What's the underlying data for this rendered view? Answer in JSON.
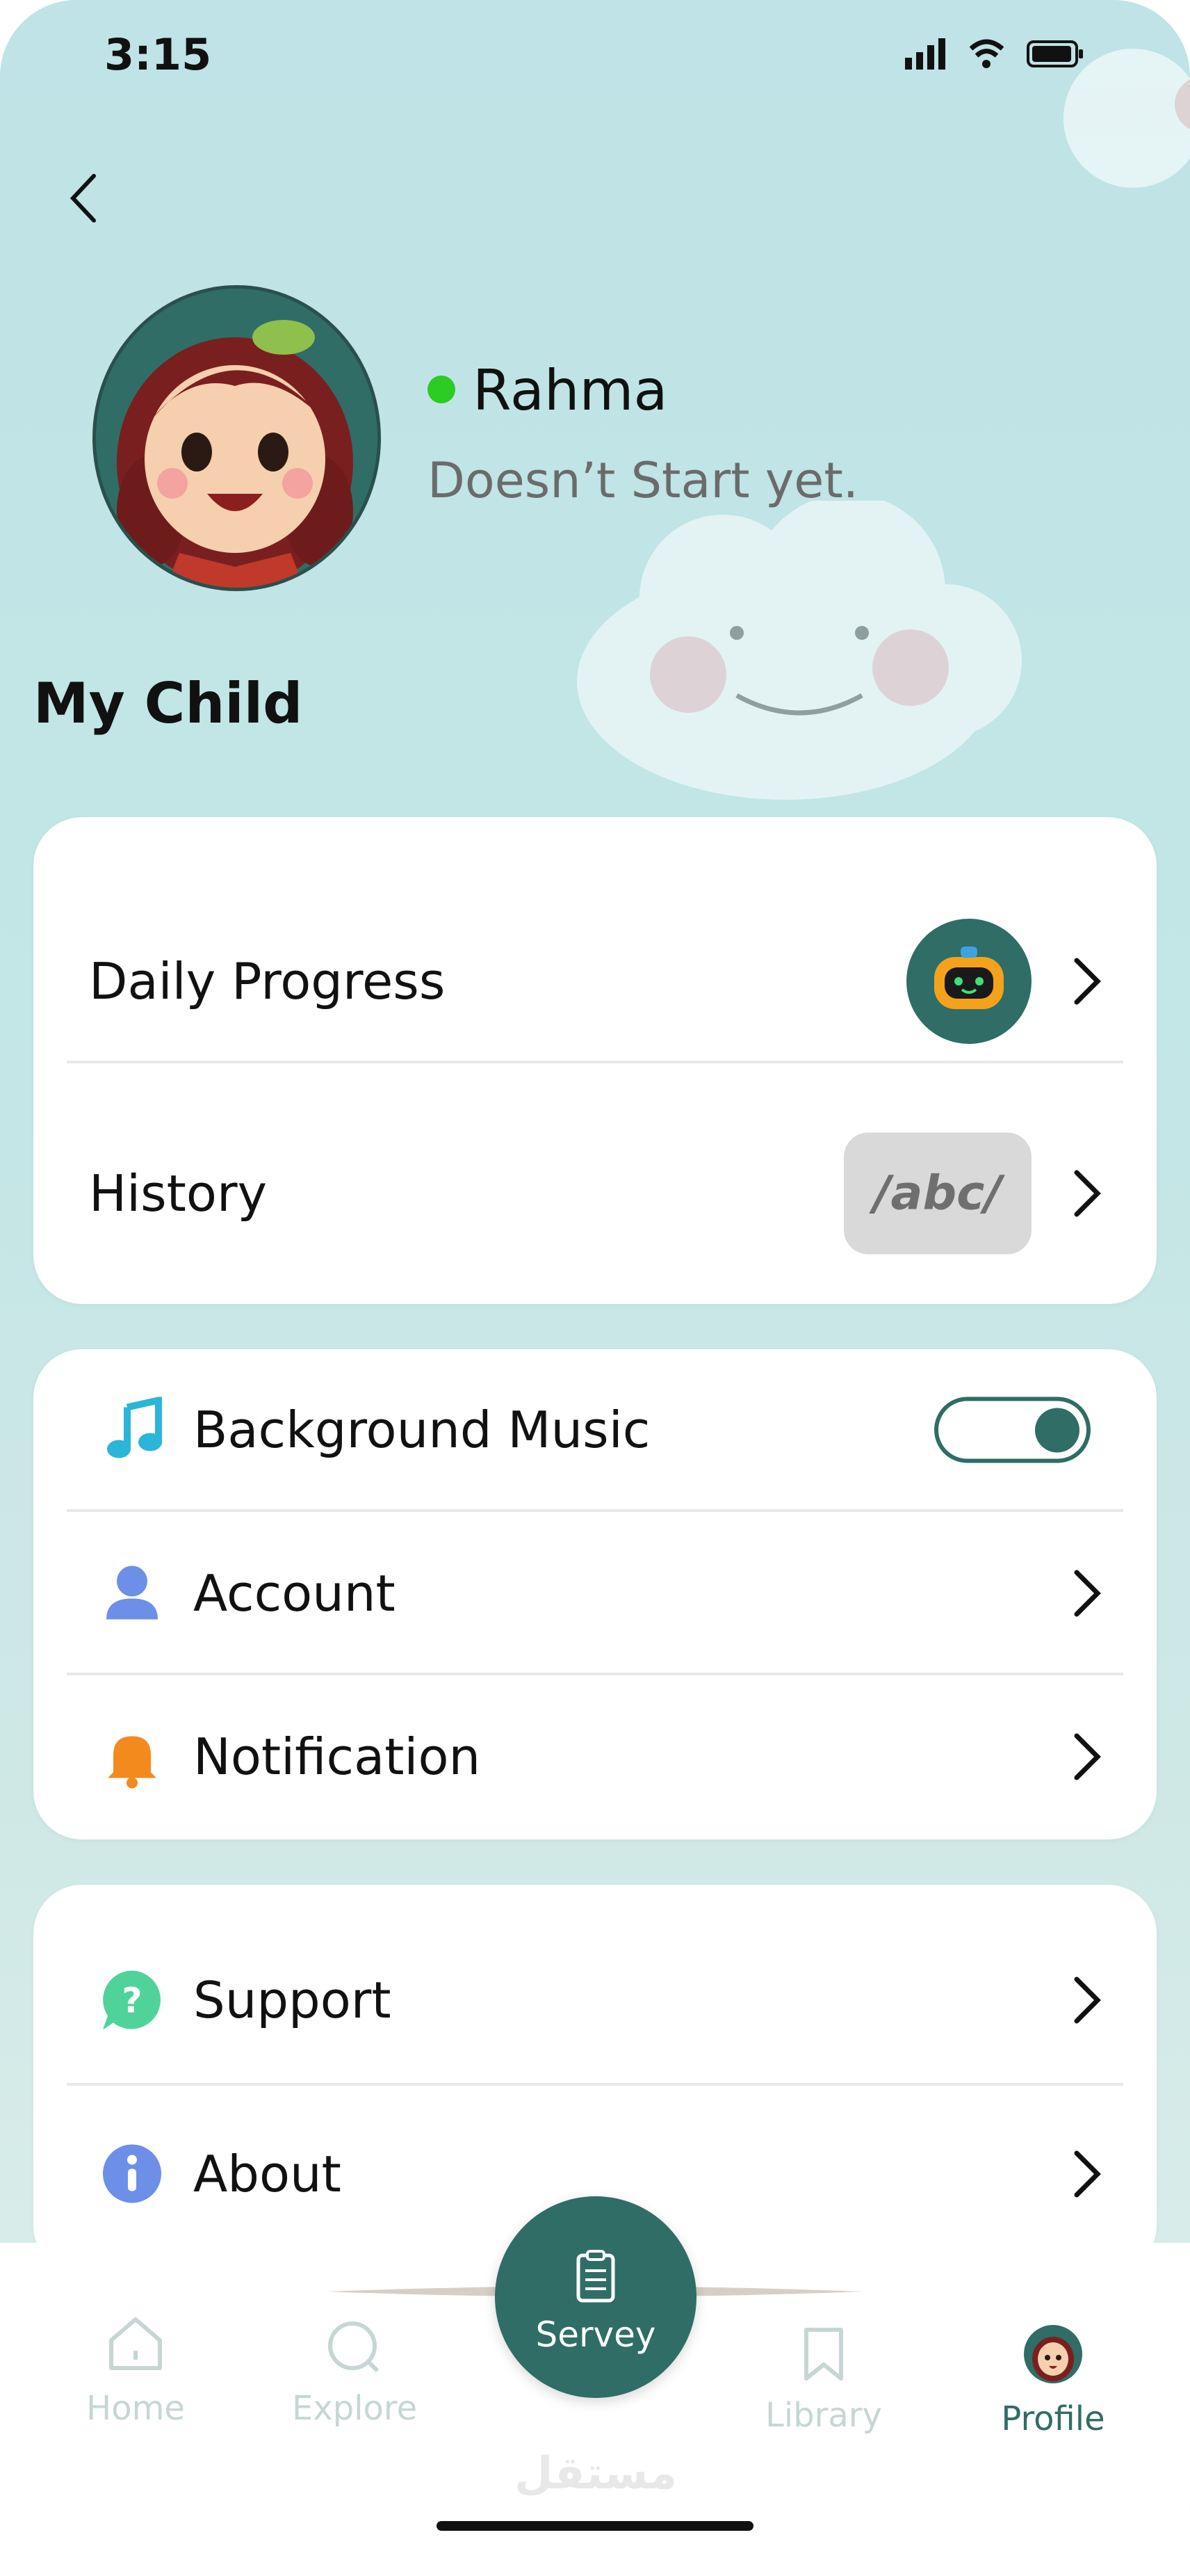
{
  "status_bar": {
    "time": "3:15"
  },
  "profile": {
    "name": "Rahma",
    "status": "Doesn’t Start yet."
  },
  "section_title": "My Child",
  "card1": [
    {
      "label": "Daily Progress",
      "badge": "robot-icon"
    },
    {
      "label": "History",
      "badge_text": "/abc/"
    }
  ],
  "card2": [
    {
      "label": "Background Music",
      "icon": "music-note-icon",
      "toggle_on": true
    },
    {
      "label": "Account",
      "icon": "person-icon"
    },
    {
      "label": "Notification",
      "icon": "bell-icon"
    }
  ],
  "card3": [
    {
      "label": "Support",
      "icon": "question-icon"
    },
    {
      "label": "About",
      "icon": "info-icon"
    }
  ],
  "nav": {
    "home": "Home",
    "explore": "Explore",
    "survey": "Servey",
    "library": "Library",
    "profile": "Profile"
  },
  "watermark": "مستقل",
  "colors": {
    "accent": "#2f6d66",
    "online": "#2ccc22",
    "active_nav": "#2f6d66",
    "inactive_nav": "#c6d6d4"
  }
}
